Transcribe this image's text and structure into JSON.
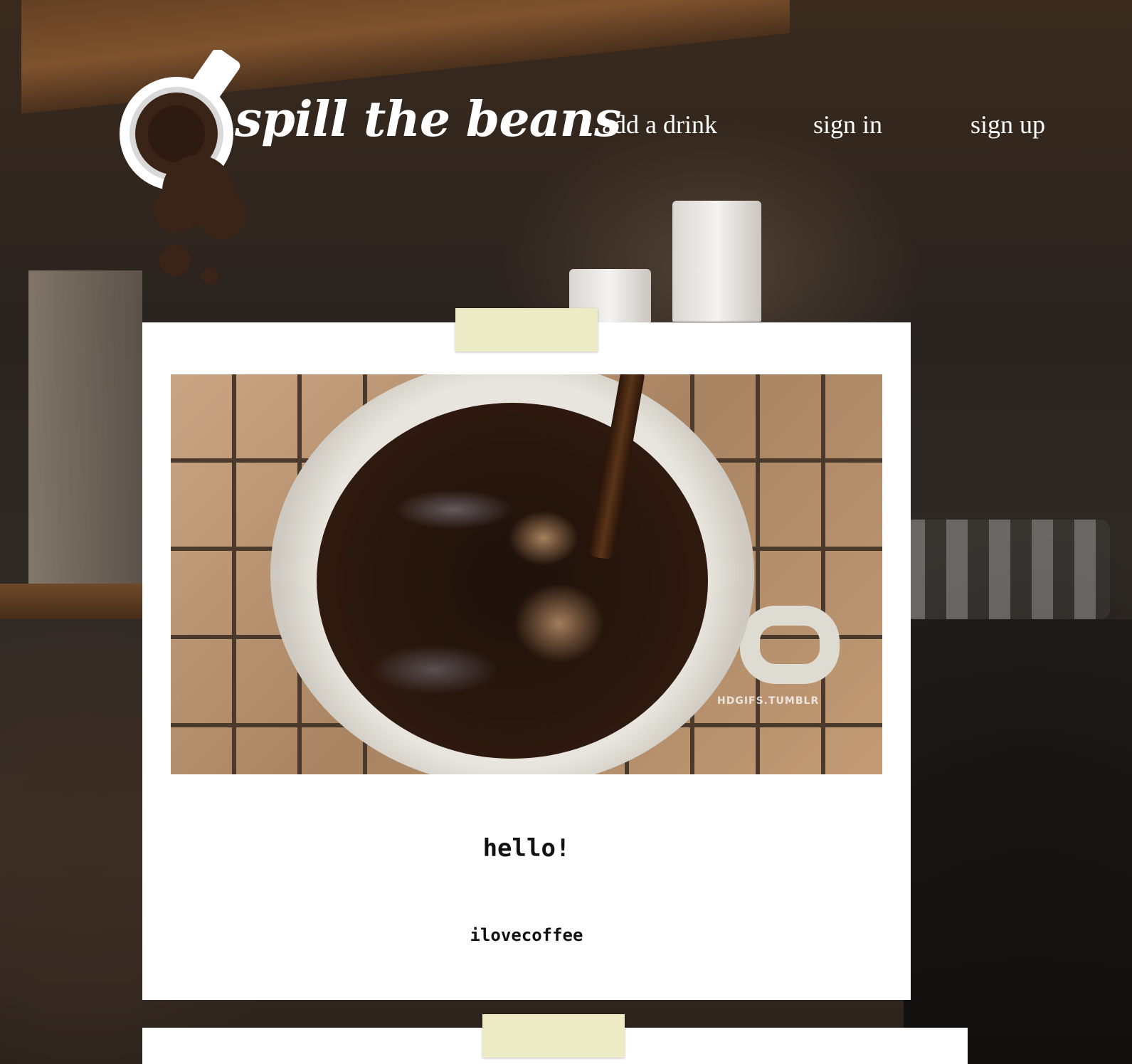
{
  "header": {
    "brand": "spill the beans",
    "nav": {
      "add_drink": "add a drink",
      "sign_in": "sign in",
      "sign_up": "sign up"
    }
  },
  "profile_card": {
    "photo_watermark": "HDGIFS.TUMBLR",
    "greeting": "hello!",
    "username": "ilovecoffee"
  },
  "icons": {
    "logo": "coffee-cup-spill-icon"
  },
  "colors": {
    "coffee_dark": "#3a2418",
    "tape": "#ecebc6",
    "card": "#ffffff",
    "nav_text": "#ffffff"
  }
}
